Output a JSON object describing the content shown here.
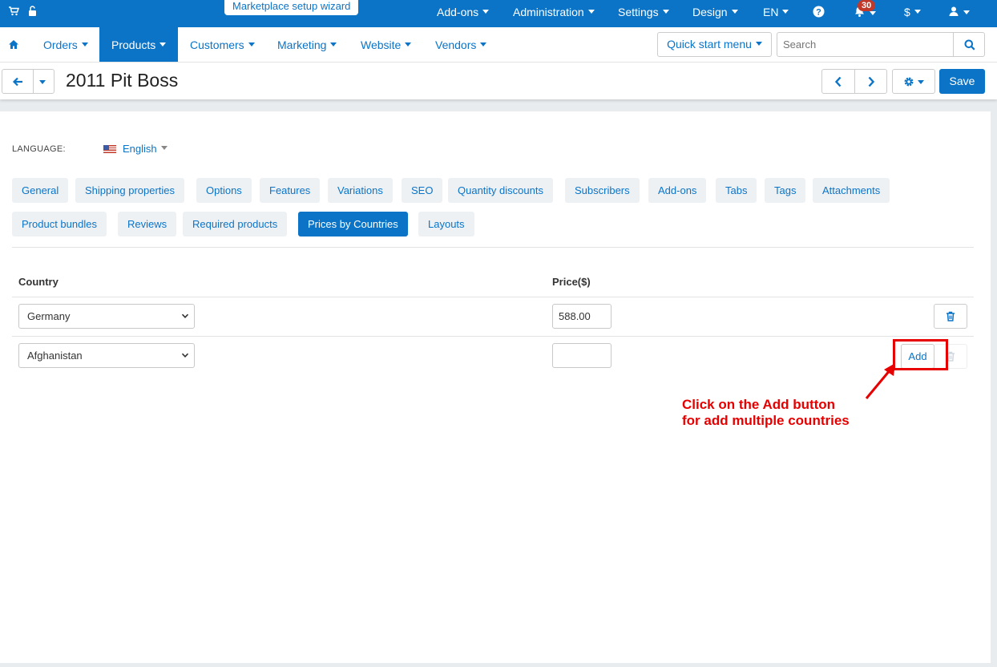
{
  "topbar": {
    "wizard_label": "Marketplace setup wizard",
    "menus": [
      "Add-ons",
      "Administration",
      "Settings",
      "Design",
      "EN"
    ],
    "notifications_count": "30",
    "currency": "$",
    "color": "#0b74c7"
  },
  "nav": {
    "items": [
      "Orders",
      "Products",
      "Customers",
      "Marketing",
      "Website",
      "Vendors"
    ],
    "active": "Products",
    "quick_start_label": "Quick start menu",
    "search_placeholder": "Search"
  },
  "title": {
    "text": "2011 Pit Boss",
    "save_label": "Save"
  },
  "language": {
    "label": "LANGUAGE:",
    "value": "English"
  },
  "tabs": {
    "row1": [
      "General",
      "Shipping properties",
      "Options",
      "Features",
      "Variations",
      "SEO",
      "Quantity discounts",
      "Subscribers",
      "Add-ons",
      "Tabs",
      "Tags",
      "Attachments"
    ],
    "row2": [
      "Product bundles",
      "Reviews",
      "Required products",
      "Prices by Countries",
      "Layouts"
    ],
    "active": "Prices by Countries"
  },
  "table": {
    "col_country": "Country",
    "col_price": "Price($)",
    "rows": [
      {
        "country": "Germany",
        "price": "588.00"
      },
      {
        "country": "Afghanistan",
        "price": ""
      }
    ],
    "add_label": "Add"
  },
  "annotation": {
    "line1": "Click on the Add button",
    "line2": "for add multiple countries",
    "color": "#e60000"
  }
}
